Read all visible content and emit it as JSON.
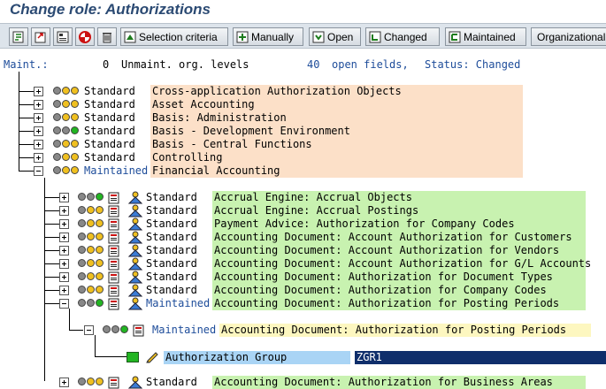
{
  "title": "Change role: Authorizations",
  "toolbar": {
    "buttons": [
      {
        "icon": "back-icon"
      },
      {
        "icon": "export-icon"
      },
      {
        "icon": "layout-icon"
      },
      {
        "icon": "help-icon"
      },
      {
        "icon": "trash-icon"
      },
      {
        "icon": "selection-icon",
        "label": "Selection criteria"
      },
      {
        "icon": "manual-icon",
        "label": "Manually"
      },
      {
        "icon": "open-icon",
        "label": "Open"
      },
      {
        "icon": "changed-icon",
        "label": "Changed"
      },
      {
        "icon": "maintained-icon",
        "label": "Maintained"
      },
      {
        "label": "Organizational"
      }
    ]
  },
  "status": {
    "maint_label": "Maint.:",
    "unmaint_count": "0",
    "unmaint_label": "Unmaint. org. levels",
    "open_count": "40",
    "open_label": "open fields,",
    "status_label": "Status: Changed"
  },
  "tree": {
    "level1": [
      {
        "status": "Standard",
        "name": "Cross-application Authorization Objects",
        "lights": [
          "g",
          "y",
          "y"
        ]
      },
      {
        "status": "Standard",
        "name": "Asset Accounting",
        "lights": [
          "g",
          "y",
          "y"
        ]
      },
      {
        "status": "Standard",
        "name": "Basis: Administration",
        "lights": [
          "g",
          "y",
          "y"
        ]
      },
      {
        "status": "Standard",
        "name": "Basis - Development Environment",
        "lights": [
          "g",
          "g",
          "gr"
        ]
      },
      {
        "status": "Standard",
        "name": "Basis - Central Functions",
        "lights": [
          "g",
          "y",
          "y"
        ]
      },
      {
        "status": "Standard",
        "name": "Controlling",
        "lights": [
          "g",
          "y",
          "y"
        ]
      },
      {
        "status": "Maintained",
        "name": "Financial Accounting",
        "lights": [
          "g",
          "y",
          "y"
        ]
      }
    ],
    "level2": [
      {
        "status": "Standard",
        "name": "Accrual Engine: Accrual Objects",
        "lights": [
          "g",
          "g",
          "gr"
        ]
      },
      {
        "status": "Standard",
        "name": "Accrual Engine: Accrual Postings",
        "lights": [
          "g",
          "y",
          "y"
        ]
      },
      {
        "status": "Standard",
        "name": "Payment Advice: Authorization for Company Codes",
        "lights": [
          "g",
          "y",
          "y"
        ]
      },
      {
        "status": "Standard",
        "name": "Accounting Document: Account Authorization for Customers",
        "lights": [
          "g",
          "y",
          "y"
        ]
      },
      {
        "status": "Standard",
        "name": "Accounting Document: Account Authorization for Vendors",
        "lights": [
          "g",
          "y",
          "y"
        ]
      },
      {
        "status": "Standard",
        "name": "Accounting Document: Account Authorization for G/L Accounts",
        "lights": [
          "g",
          "y",
          "y"
        ]
      },
      {
        "status": "Standard",
        "name": "Accounting Document: Authorization for Document Types",
        "lights": [
          "g",
          "y",
          "y"
        ]
      },
      {
        "status": "Standard",
        "name": "Accounting Document: Authorization for Company Codes",
        "lights": [
          "g",
          "y",
          "y"
        ]
      },
      {
        "status": "Maintained",
        "name": "Accounting Document: Authorization for Posting Periods",
        "lights": [
          "g",
          "g",
          "gr"
        ]
      }
    ],
    "level3": {
      "status": "Maintained",
      "name": "Accounting Document: Authorization for Posting Periods",
      "lights": [
        "g",
        "g",
        "gr"
      ]
    },
    "field": {
      "name": "Authorization Group",
      "value": "ZGR1"
    },
    "partial_row": {
      "status": "Standard",
      "name": "Accounting Document: Authorization for Business Areas"
    }
  },
  "colors": {
    "orange_band": "#fce0c8",
    "green_band": "#c8f2b0",
    "yellow_band": "#fdf7c0",
    "field_label": "#a9d4f5",
    "field_value": "#0f2e6b"
  }
}
